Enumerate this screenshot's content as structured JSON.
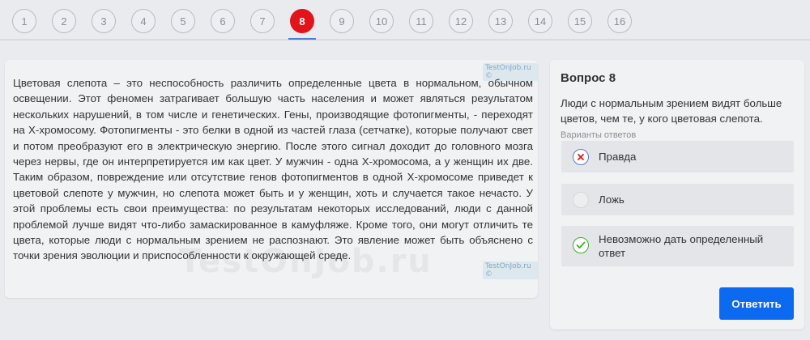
{
  "nav": {
    "questions": [
      "1",
      "2",
      "3",
      "4",
      "5",
      "6",
      "7",
      "8",
      "9",
      "10",
      "11",
      "12",
      "13",
      "14",
      "15",
      "16"
    ],
    "active": "8"
  },
  "article": {
    "text": "Цветовая слепота – это неспособность различить определенные цвета в нормальном, обычном освещении. Этот феномен затрагивает большую часть населения и может являться результатом нескольких нарушений, в том числе и генетических. Гены, производящие фотопигменты, - переходят на X-хромосому. Фотопигменты - это белки в одной из частей глаза (сетчатке), которые получают свет и потом преобразуют его в электрическую энергию. После этого сигнал доходит до головного мозга через нервы, где он интерпретируется им как цвет. У мужчин - одна X-хромосома, а у женщин их две. Таким образом, повреждение или отсутствие генов фотопигментов в одной X-хромосоме приведет к цветовой слепоте у мужчин, но слепота может быть и у женщин, хоть и случается такое нечасто. У этой проблемы есть свои преимущества: по результатам некоторых исследований, люди с данной проблемой лучше видят что-либо замаскированное в камуфляже. Кроме того, они могут отличить те цвета, которые люди с нормальным зрением не распознают. Это явление может быть объяснено с точки зрения эволюции и приспособленности к окружающей среде.",
    "watermark_small": "TestOnJob.ru ©",
    "watermark_big": "TestOnJob.ru"
  },
  "question": {
    "title": "Вопрос 8",
    "text": "Люди с нормальным зрением видят больше цветов, чем те, у кого цветовая слепота.",
    "hint": "Варианты ответов",
    "answers": [
      {
        "label": "Правда",
        "state": "wrong",
        "icon": "cross-icon"
      },
      {
        "label": "Ложь",
        "state": "none",
        "icon": "empty-circle-icon"
      },
      {
        "label": "Невозможно дать определенный ответ",
        "state": "correct",
        "icon": "check-icon"
      }
    ],
    "submit_label": "Ответить"
  },
  "colors": {
    "active": "#e3131b",
    "wrong": "#e3131b",
    "correct": "#3fae2a",
    "button": "#0b6af0"
  }
}
